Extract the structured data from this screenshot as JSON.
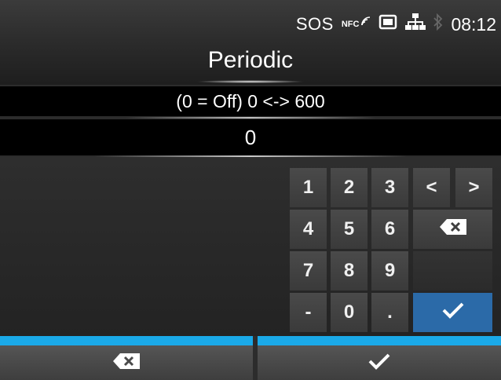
{
  "status": {
    "sos": "SOS",
    "nfc": "NFC",
    "time": "08:12"
  },
  "header": {
    "title": "Periodic"
  },
  "input": {
    "range_hint": "(0 = Off) 0 <-> 600",
    "value": "0"
  },
  "keypad": {
    "k1": "1",
    "k2": "2",
    "k3": "3",
    "k4": "4",
    "k5": "5",
    "k6": "6",
    "k7": "7",
    "k8": "8",
    "k9": "9",
    "minus": "-",
    "k0": "0",
    "dot": ".",
    "left": "<",
    "right": ">"
  },
  "icons": {
    "backspace": "backspace-icon",
    "enter": "checkmark-icon"
  },
  "colors": {
    "accent": "#1aa9e8",
    "enter_key": "#2b6aa8"
  }
}
